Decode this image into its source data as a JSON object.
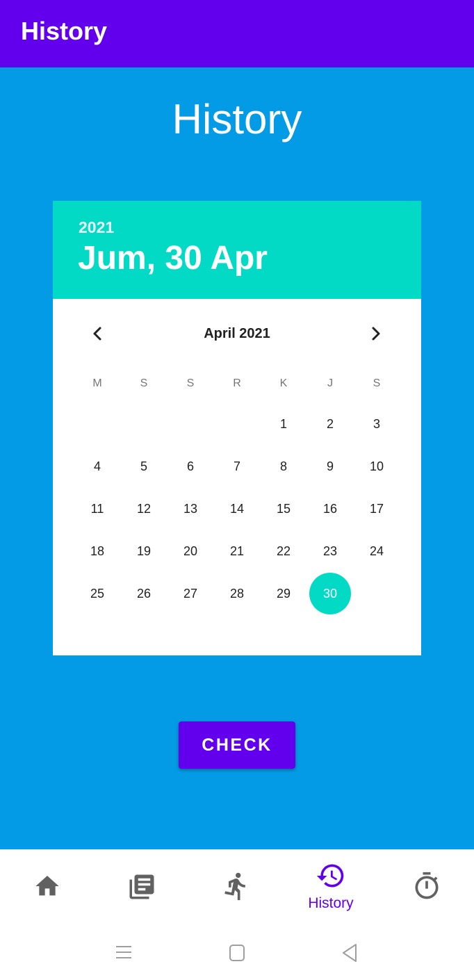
{
  "appbar": {
    "title": "History"
  },
  "page": {
    "title": "History"
  },
  "picker": {
    "year": "2021",
    "selected_date": "Jum, 30 Apr",
    "month_label": "April 2021",
    "weekdays": [
      "M",
      "S",
      "S",
      "R",
      "K",
      "J",
      "S"
    ],
    "weeks": [
      [
        "",
        "",
        "",
        "",
        "1",
        "2",
        "3"
      ],
      [
        "4",
        "5",
        "6",
        "7",
        "8",
        "9",
        "10"
      ],
      [
        "11",
        "12",
        "13",
        "14",
        "15",
        "16",
        "17"
      ],
      [
        "18",
        "19",
        "20",
        "21",
        "22",
        "23",
        "24"
      ],
      [
        "25",
        "26",
        "27",
        "28",
        "29",
        "30",
        ""
      ]
    ],
    "selected_day": "30",
    "prev_icon": "chevron-left-icon",
    "next_icon": "chevron-right-icon"
  },
  "check_button": {
    "label": "CHECK"
  },
  "bottom_nav": {
    "items": [
      {
        "icon": "home-icon",
        "label": "",
        "active": false
      },
      {
        "icon": "library-books-icon",
        "label": "",
        "active": false
      },
      {
        "icon": "running-person-icon",
        "label": "",
        "active": false
      },
      {
        "icon": "history-icon",
        "label": "History",
        "active": true
      },
      {
        "icon": "timer-icon",
        "label": "",
        "active": false
      }
    ]
  },
  "system_nav": {
    "icons": [
      "recents-icon",
      "home-square-icon",
      "back-triangle-icon"
    ]
  },
  "colors": {
    "appbar": "#6200EE",
    "background": "#039BE5",
    "picker_header": "#03DAC5",
    "button": "#6200EE",
    "active_nav": "#6200EE",
    "inactive_nav": "#616161"
  }
}
